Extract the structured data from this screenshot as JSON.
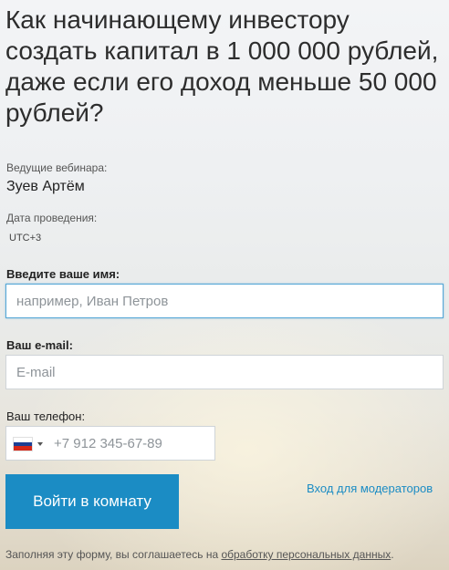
{
  "webinar": {
    "title": "Как начинающему инвестору создать капитал в 1 000 000 рублей, даже если его доход меньше 50 000 рублей?",
    "presenters_label": "Ведущие вебинара:",
    "presenter_name": "Зуев Артём",
    "date_label": "Дата проведения:",
    "timezone": "UTC+3"
  },
  "form": {
    "name_label": "Введите ваше имя:",
    "name_placeholder": "например, Иван Петров",
    "email_label": "Ваш e-mail:",
    "email_placeholder": "E-mail",
    "phone_label": "Ваш телефон:",
    "phone_country": "ru",
    "phone_placeholder": "+7 912 345-67-89",
    "submit_label": "Войти в комнату",
    "moderator_link": "Вход для модераторов"
  },
  "consent": {
    "text": "Заполняя эту форму, вы соглашаетесь на ",
    "link_text": "обработку персональных данных",
    "end": "."
  },
  "colors": {
    "accent": "#1b8cc4",
    "focus_border": "#54a6d6"
  }
}
